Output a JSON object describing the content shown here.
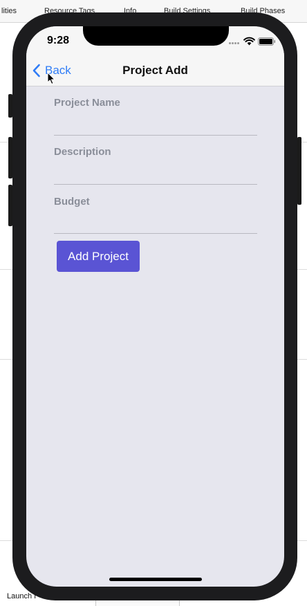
{
  "xcode": {
    "tabs": [
      "lities",
      "Resource Tags",
      "Info",
      "Build Settings",
      "Build Phases"
    ],
    "bottom_text": "Launch I"
  },
  "status_bar": {
    "time": "9:28"
  },
  "nav": {
    "back_label": "Back",
    "title": "Project Add"
  },
  "form": {
    "fields": [
      {
        "label": "Project Name",
        "value": ""
      },
      {
        "label": "Description",
        "value": ""
      },
      {
        "label": "Budget",
        "value": ""
      }
    ],
    "submit_label": "Add Project"
  },
  "colors": {
    "accent": "#2f7cf6",
    "button": "#5a54d4",
    "background": "#e6e6ee",
    "label": "#8a8e99"
  }
}
